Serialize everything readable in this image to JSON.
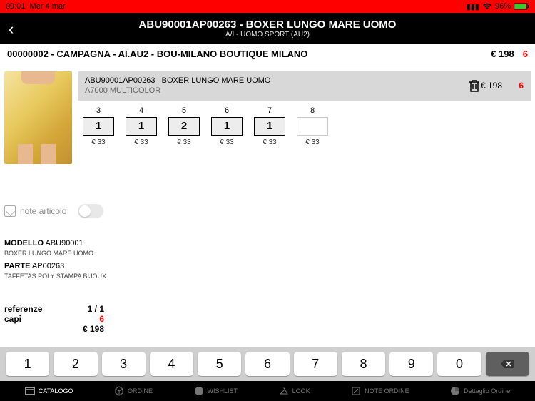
{
  "status": {
    "time": "09:01",
    "date": "Mer 4 mar",
    "battery": "96%"
  },
  "header": {
    "title": "ABU90001AP00263 - BOXER LUNGO MARE UOMO",
    "subtitle": "A/I - UOMO SPORT (AU2)"
  },
  "crumb": {
    "text": "00000002 - CAMPAGNA - AI.AU2 - BOU-MILANO  BOUTIQUE MILANO",
    "price": "€ 198",
    "qty": "6"
  },
  "product": {
    "code": "ABU90001AP00263",
    "name": "BOXER LUNGO MARE UOMO",
    "color": "A7000   MULTICOLOR",
    "price": "€ 198",
    "qty": "6"
  },
  "sizes": [
    {
      "label": "3",
      "qty": "1",
      "price": "€ 33"
    },
    {
      "label": "4",
      "qty": "1",
      "price": "€ 33"
    },
    {
      "label": "5",
      "qty": "2",
      "price": "€ 33"
    },
    {
      "label": "6",
      "qty": "1",
      "price": "€ 33"
    },
    {
      "label": "7",
      "qty": "1",
      "price": "€ 33"
    },
    {
      "label": "8",
      "qty": "",
      "price": "€ 33"
    }
  ],
  "notes": {
    "label": "note articolo"
  },
  "details": {
    "modello_lbl": "MODELLO",
    "modello_val": "ABU90001",
    "modello_desc": "BOXER LUNGO MARE UOMO",
    "parte_lbl": "PARTE",
    "parte_val": "AP00263",
    "parte_desc": "TAFFETAS POLY STAMPA BIJOUX"
  },
  "summary": {
    "ref_lbl": "referenze",
    "ref_val": "1 / 1",
    "capi_lbl": "capi",
    "capi_val": "6",
    "total": "€ 198"
  },
  "keypad": [
    "1",
    "2",
    "3",
    "4",
    "5",
    "6",
    "7",
    "8",
    "9",
    "0"
  ],
  "tabs": {
    "catalogo": "CATALOGO",
    "ordine": "ORDINE",
    "wishlist": "WISHLIST",
    "look": "LOOK",
    "note": "NOTE ORDINE",
    "dettaglio": "Dettaglio Ordine"
  }
}
